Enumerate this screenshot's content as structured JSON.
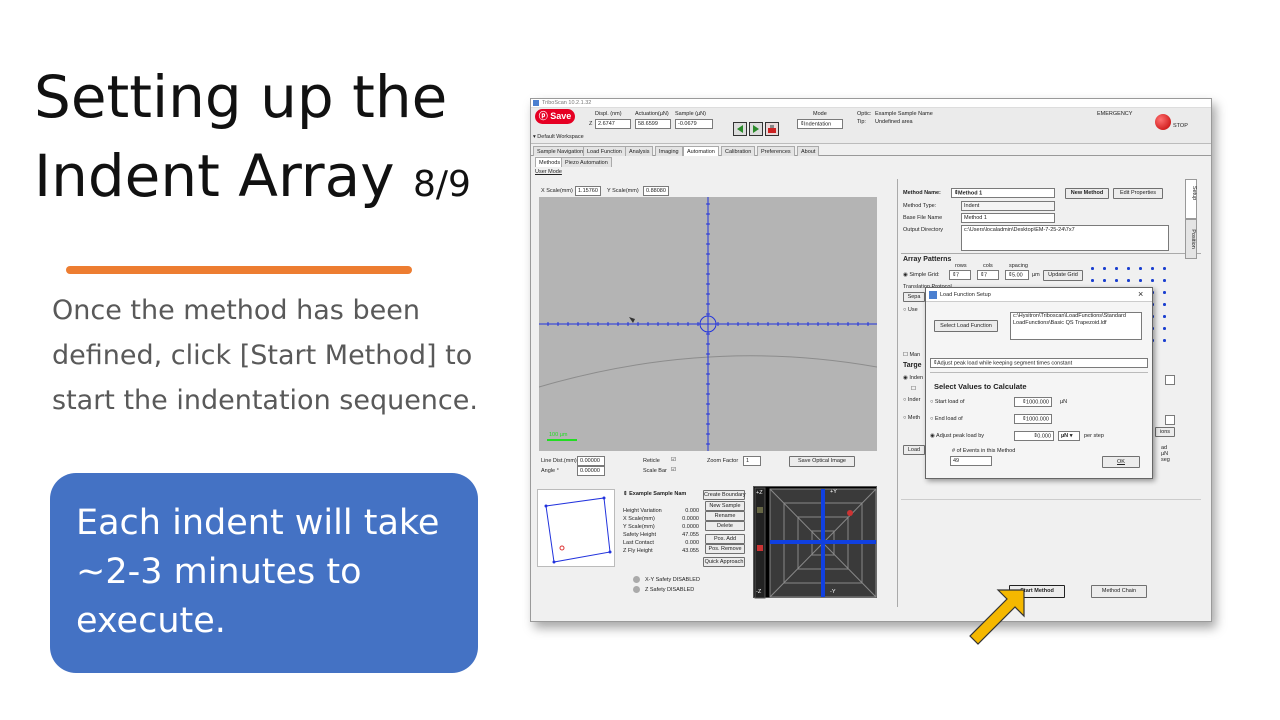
{
  "slide": {
    "title_line1": "Setting up the",
    "title_line2": "Indent Array",
    "page": "8/9",
    "body": "Once the method has been defined, click [Start Method] to start the indentation sequence.",
    "callout": "Each indent will take ~2-3 minutes to execute.",
    "colors": {
      "underline": "#ed7d31",
      "callout": "#4472c4",
      "arrow": "#f5b800"
    }
  },
  "app": {
    "window_title": "TriboScan 10.2.1.32",
    "save_label": "Save",
    "workspace": "Default Workspace",
    "displacement": {
      "label": "Displ. (nm)",
      "z_label": "Z",
      "value": "2.6747"
    },
    "actuation": {
      "label": "Actuation(µN)",
      "value": "58.6599"
    },
    "sample": {
      "label": "Sample (µN)",
      "value": "-0.0679"
    },
    "mode": {
      "label": "Mode",
      "value": "Indentation"
    },
    "optic_label": "Optic:",
    "optic_value": "Example Sample Name",
    "tip_label": "Tip:",
    "tip_value": "Undefined area",
    "emergency": "EMERGENCY",
    "stop": "STOP",
    "tabs": [
      "Sample Navigation",
      "Load Function",
      "Analysis",
      "Imaging",
      "Automation",
      "Calibration",
      "Preferences",
      "About"
    ],
    "subtabs": [
      "Methods",
      "Piezo Automation"
    ],
    "user_mode": "User Mode",
    "x_scale": {
      "label": "X Scale(mm)",
      "value": "1.15760"
    },
    "y_scale": {
      "label": "Y Scale(mm)",
      "value": "0.88080"
    },
    "scale_bar": "100 µm",
    "line_dist": {
      "label": "Line Dist.(mm)",
      "value": "0.00000"
    },
    "angle": {
      "label": "Angle °",
      "value": "0.00000"
    },
    "reticle_label": "Reticle",
    "scalebar_label": "Scale Bar",
    "zoom": {
      "label": "Zoom Factor",
      "value": "1"
    },
    "save_optical": "Save Optical Image",
    "sample_panel": {
      "name": "Example Sample Nam",
      "rows": [
        {
          "label": "Height Variation",
          "value": "0.000"
        },
        {
          "label": "X Scale(mm)",
          "value": "0.0000"
        },
        {
          "label": "Y Scale(mm)",
          "value": "0.0000"
        },
        {
          "label": "Safety Height",
          "value": "47.055"
        },
        {
          "label": "Last Contact",
          "value": "0.000"
        },
        {
          "label": "Z Fly Height",
          "value": "43.055"
        }
      ],
      "buttons": [
        "Create Boundary",
        "New Sample",
        "Rename",
        "Delete",
        "Pos. Add",
        "Pos. Remove",
        "Quick Approach"
      ]
    },
    "safety": [
      "X-Y Safety DISABLED",
      "Z  Safety DISABLED"
    ],
    "nav_labels": {
      "plus_y": "+Y",
      "minus_y": "-Y",
      "plus_z": "+Z",
      "minus_z": "-Z"
    },
    "method": {
      "name_label": "Method Name:",
      "name_value": "Method 1",
      "new_method": "New Method",
      "edit_properties": "Edit Properties",
      "type_label": "Method Type:",
      "type_value": "Indent",
      "base_label": "Base File Name",
      "base_value": "Method 1",
      "output_label": "Output Directory",
      "output_value": "c:\\Users\\localadmin\\Desktop\\EM-7-25-24\\7x7",
      "array_patterns": "Array Patterns",
      "rows_label": "rows",
      "cols_label": "cols",
      "spacing_label": "spacing",
      "simple_grid": "Simple Grid:",
      "rows_value": "7",
      "cols_value": "7",
      "spacing_value": "5.00",
      "spacing_unit": "µm",
      "update_grid": "Update Grid",
      "translation_label": "Translation Protocol",
      "sep_short": "Sepa",
      "use_short": "Use",
      "man_short": "Man",
      "targets_short": "Targe",
      "inden_short": "Inden",
      "inder_short": "Inder",
      "meth_short": "Meth",
      "load_short": "Load",
      "side_tabs": [
        "Setup",
        "Position"
      ],
      "start_method": "Start Method",
      "method_chain": "Method Chain",
      "right_frag": [
        "ad",
        "µN",
        "seg"
      ],
      "right_frag2": "ions"
    },
    "dialog": {
      "title": "Load Function Setup",
      "close": "×",
      "select_lf": "Select Load Function",
      "path": "c:\\Hysitron\\Triboscan\\LoadFunctions\\Standard LoadFunctions\\Basic QS Trapezoid.ldf",
      "mode_value": "Adjust peak load while keeping segment times constant",
      "select_values": "Select Values to Calculate",
      "start_load": {
        "label": "Start load of",
        "value": "1000.000",
        "unit": "µN"
      },
      "end_load": {
        "label": "End load of",
        "value": "1000.000"
      },
      "adjust_peak": {
        "label": "Adjust peak load by",
        "value": "0.000",
        "unit": "µN",
        "suffix": "per step"
      },
      "events_label": "# of Events in this Method",
      "events_value": "49",
      "ok": "OK"
    }
  }
}
